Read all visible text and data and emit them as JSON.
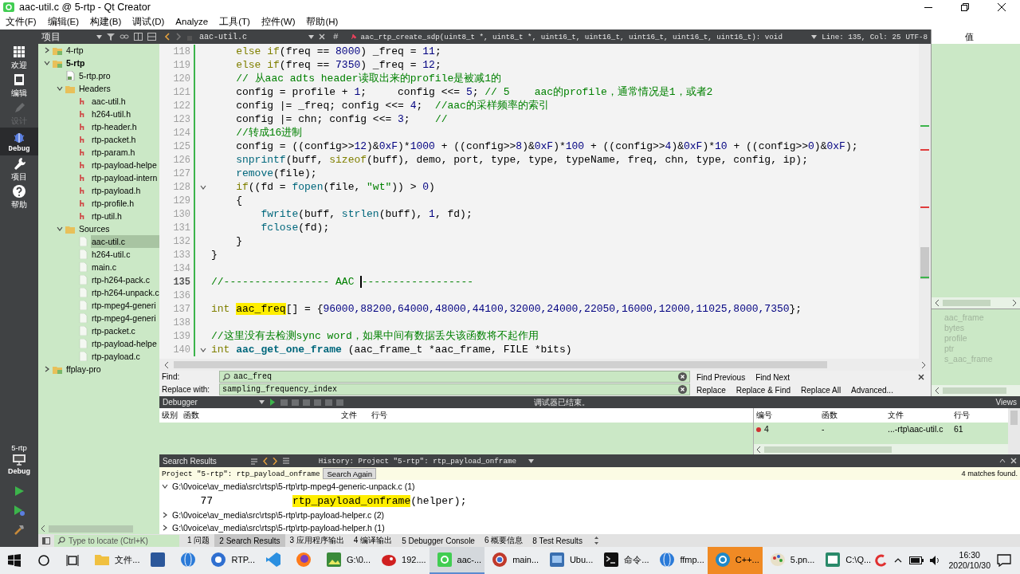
{
  "window": {
    "title": "aac-util.c @ 5-rtp - Qt Creator"
  },
  "menu": [
    "文件(F)",
    "编辑(E)",
    "构建(B)",
    "调试(D)",
    "Analyze",
    "工具(T)",
    "控件(W)",
    "帮助(H)"
  ],
  "modes": [
    {
      "label": "欢迎",
      "kind": "welcome",
      "selected": false,
      "disabled": false
    },
    {
      "label": "编辑",
      "kind": "edit",
      "selected": false,
      "disabled": false
    },
    {
      "label": "设计",
      "kind": "design",
      "selected": false,
      "disabled": true
    },
    {
      "label": "Debug",
      "kind": "debug",
      "selected": true,
      "disabled": false
    },
    {
      "label": "项目",
      "kind": "projects",
      "selected": false,
      "disabled": false
    },
    {
      "label": "帮助",
      "kind": "help",
      "selected": false,
      "disabled": false
    }
  ],
  "kit": {
    "project": "5-rtp",
    "build": "Debug"
  },
  "projects": {
    "title": "项目",
    "tree": [
      {
        "label": "4-rtp",
        "kind": "project",
        "active": false,
        "expanded": false,
        "selected": false
      },
      {
        "label": "5-rtp",
        "kind": "project",
        "active": true,
        "expanded": true,
        "selected": false,
        "children": [
          {
            "label": "5-rtp.pro",
            "kind": "pro",
            "selected": false
          },
          {
            "label": "Headers",
            "kind": "folder",
            "expanded": true,
            "selected": false,
            "children": [
              {
                "label": "aac-util.h",
                "kind": "header",
                "selected": false
              },
              {
                "label": "h264-util.h",
                "kind": "header",
                "selected": false
              },
              {
                "label": "rtp-header.h",
                "kind": "header",
                "selected": false
              },
              {
                "label": "rtp-packet.h",
                "kind": "header",
                "selected": false
              },
              {
                "label": "rtp-param.h",
                "kind": "header",
                "selected": false
              },
              {
                "label": "rtp-payload-helpe",
                "kind": "header",
                "selected": false
              },
              {
                "label": "rtp-payload-intern",
                "kind": "header",
                "selected": false
              },
              {
                "label": "rtp-payload.h",
                "kind": "header",
                "selected": false
              },
              {
                "label": "rtp-profile.h",
                "kind": "header",
                "selected": false
              },
              {
                "label": "rtp-util.h",
                "kind": "header",
                "selected": false
              }
            ]
          },
          {
            "label": "Sources",
            "kind": "folder",
            "expanded": true,
            "selected": false,
            "children": [
              {
                "label": "aac-util.c",
                "kind": "source",
                "selected": true
              },
              {
                "label": "h264-util.c",
                "kind": "source",
                "selected": false
              },
              {
                "label": "main.c",
                "kind": "source",
                "selected": false
              },
              {
                "label": "rtp-h264-pack.c",
                "kind": "source",
                "selected": false
              },
              {
                "label": "rtp-h264-unpack.c",
                "kind": "source",
                "selected": false
              },
              {
                "label": "rtp-mpeg4-generi",
                "kind": "source",
                "selected": false
              },
              {
                "label": "rtp-mpeg4-generi",
                "kind": "source",
                "selected": false
              },
              {
                "label": "rtp-packet.c",
                "kind": "source",
                "selected": false
              },
              {
                "label": "rtp-payload-helpe",
                "kind": "source",
                "selected": false
              },
              {
                "label": "rtp-payload.c",
                "kind": "source",
                "selected": false
              }
            ]
          }
        ]
      },
      {
        "label": "ffplay-pro",
        "kind": "project",
        "active": false,
        "expanded": false,
        "selected": false
      }
    ]
  },
  "editor": {
    "file": "aac-util.c",
    "hash": "#",
    "symbol": "aac_rtp_create_sdp(uint8_t *, uint8_t *, uint16_t, uint16_t, uint16_t, uint16_t, uint16_t): void",
    "position": "Line: 135, Col: 25",
    "encoding": "UTF-8",
    "lines": [
      {
        "number": "118",
        "current": false,
        "foldable": false,
        "spans": [
          {
            "kind": "keyword",
            "text": "    else if"
          },
          {
            "kind": "plain",
            "text": "(freq == "
          },
          {
            "kind": "number",
            "text": "8000"
          },
          {
            "kind": "plain",
            "text": ") _freq = "
          },
          {
            "kind": "number",
            "text": "11"
          },
          {
            "kind": "plain",
            "text": ";"
          }
        ]
      },
      {
        "number": "119",
        "current": false,
        "foldable": false,
        "spans": [
          {
            "kind": "keyword",
            "text": "    else if"
          },
          {
            "kind": "plain",
            "text": "(freq == "
          },
          {
            "kind": "number",
            "text": "7350"
          },
          {
            "kind": "plain",
            "text": ") _freq = "
          },
          {
            "kind": "number",
            "text": "12"
          },
          {
            "kind": "plain",
            "text": ";"
          }
        ]
      },
      {
        "number": "120",
        "current": false,
        "foldable": false,
        "spans": [
          {
            "kind": "comment",
            "text": "    // 从aac adts header读取出来的profile是被减1的"
          }
        ]
      },
      {
        "number": "121",
        "current": false,
        "foldable": false,
        "spans": [
          {
            "kind": "plain",
            "text": "    config = profile + "
          },
          {
            "kind": "number",
            "text": "1"
          },
          {
            "kind": "plain",
            "text": ";     config <<= "
          },
          {
            "kind": "number",
            "text": "5"
          },
          {
            "kind": "plain",
            "text": "; "
          },
          {
            "kind": "comment",
            "text": "// 5    aac的profile，通常情况是1，或者2"
          }
        ]
      },
      {
        "number": "122",
        "current": false,
        "foldable": false,
        "spans": [
          {
            "kind": "plain",
            "text": "    config |= _freq; config <<= "
          },
          {
            "kind": "number",
            "text": "4"
          },
          {
            "kind": "plain",
            "text": ";  "
          },
          {
            "kind": "comment",
            "text": "//aac的采样频率的索引"
          }
        ]
      },
      {
        "number": "123",
        "current": false,
        "foldable": false,
        "spans": [
          {
            "kind": "plain",
            "text": "    config |= chn; config <<= "
          },
          {
            "kind": "number",
            "text": "3"
          },
          {
            "kind": "plain",
            "text": ";    "
          },
          {
            "kind": "comment",
            "text": "//"
          }
        ]
      },
      {
        "number": "124",
        "current": false,
        "foldable": false,
        "spans": [
          {
            "kind": "comment",
            "text": "    //转成16进制"
          }
        ]
      },
      {
        "number": "125",
        "current": false,
        "foldable": false,
        "spans": [
          {
            "kind": "plain",
            "text": "    config = ((config>>"
          },
          {
            "kind": "number",
            "text": "12"
          },
          {
            "kind": "plain",
            "text": ")&"
          },
          {
            "kind": "number",
            "text": "0xF"
          },
          {
            "kind": "plain",
            "text": ")*"
          },
          {
            "kind": "number",
            "text": "1000"
          },
          {
            "kind": "plain",
            "text": " + ((config>>"
          },
          {
            "kind": "number",
            "text": "8"
          },
          {
            "kind": "plain",
            "text": ")&"
          },
          {
            "kind": "number",
            "text": "0xF"
          },
          {
            "kind": "plain",
            "text": ")*"
          },
          {
            "kind": "number",
            "text": "100"
          },
          {
            "kind": "plain",
            "text": " + ((config>>"
          },
          {
            "kind": "number",
            "text": "4"
          },
          {
            "kind": "plain",
            "text": ")&"
          },
          {
            "kind": "number",
            "text": "0xF"
          },
          {
            "kind": "plain",
            "text": ")*"
          },
          {
            "kind": "number",
            "text": "10"
          },
          {
            "kind": "plain",
            "text": " + ((config>>"
          },
          {
            "kind": "number",
            "text": "0"
          },
          {
            "kind": "plain",
            "text": ")&"
          },
          {
            "kind": "number",
            "text": "0xF"
          },
          {
            "kind": "plain",
            "text": ");"
          }
        ]
      },
      {
        "number": "126",
        "current": false,
        "foldable": false,
        "spans": [
          {
            "kind": "function",
            "text": "    snprintf"
          },
          {
            "kind": "plain",
            "text": "(buff, "
          },
          {
            "kind": "keyword",
            "text": "sizeof"
          },
          {
            "kind": "plain",
            "text": "(buff), demo, port, type, type, typeName, freq, chn, type, config, ip);"
          }
        ]
      },
      {
        "number": "127",
        "current": false,
        "foldable": false,
        "spans": [
          {
            "kind": "function",
            "text": "    remove"
          },
          {
            "kind": "plain",
            "text": "(file);"
          }
        ]
      },
      {
        "number": "128",
        "current": false,
        "foldable": true,
        "spans": [
          {
            "kind": "keyword",
            "text": "    if"
          },
          {
            "kind": "plain",
            "text": "((fd = "
          },
          {
            "kind": "function",
            "text": "fopen"
          },
          {
            "kind": "plain",
            "text": "(file, "
          },
          {
            "kind": "string",
            "text": "\"wt\""
          },
          {
            "kind": "plain",
            "text": ")) > "
          },
          {
            "kind": "number",
            "text": "0"
          },
          {
            "kind": "plain",
            "text": ")"
          }
        ]
      },
      {
        "number": "129",
        "current": false,
        "foldable": false,
        "spans": [
          {
            "kind": "plain",
            "text": "    {"
          }
        ]
      },
      {
        "number": "130",
        "current": false,
        "foldable": false,
        "spans": [
          {
            "kind": "function",
            "text": "        fwrite"
          },
          {
            "kind": "plain",
            "text": "(buff, "
          },
          {
            "kind": "function",
            "text": "strlen"
          },
          {
            "kind": "plain",
            "text": "(buff), "
          },
          {
            "kind": "number",
            "text": "1"
          },
          {
            "kind": "plain",
            "text": ", fd);"
          }
        ]
      },
      {
        "number": "131",
        "current": false,
        "foldable": false,
        "spans": [
          {
            "kind": "function",
            "text": "        fclose"
          },
          {
            "kind": "plain",
            "text": "(fd);"
          }
        ]
      },
      {
        "number": "132",
        "current": false,
        "foldable": false,
        "spans": [
          {
            "kind": "plain",
            "text": "    }"
          }
        ]
      },
      {
        "number": "133",
        "current": false,
        "foldable": false,
        "spans": [
          {
            "kind": "plain",
            "text": "}"
          }
        ]
      },
      {
        "number": "134",
        "current": false,
        "foldable": false
      },
      {
        "number": "135",
        "current": true,
        "foldable": false,
        "spans": [
          {
            "kind": "comment",
            "text": "//----------------- AAC "
          },
          {
            "kind": "comment",
            "text": "------------------"
          }
        ]
      },
      {
        "number": "136",
        "current": false,
        "foldable": false
      },
      {
        "number": "137",
        "current": false,
        "foldable": false,
        "spans": [
          {
            "kind": "keyword",
            "text": "int "
          },
          {
            "kind": "match",
            "text": "aac_freq"
          },
          {
            "kind": "plain",
            "text": "[] = {"
          },
          {
            "kind": "number",
            "text": "96000,88200,64000,48000,44100,32000,24000,22050,16000,12000,11025,8000,7350"
          },
          {
            "kind": "plain",
            "text": "};"
          }
        ]
      },
      {
        "number": "138",
        "current": false,
        "foldable": false
      },
      {
        "number": "139",
        "current": false,
        "foldable": false,
        "spans": [
          {
            "kind": "comment",
            "text": "//这里没有去检测sync word，如果中间有数据丢失该函数将不起作用"
          }
        ]
      },
      {
        "number": "140",
        "current": false,
        "foldable": true,
        "spans": [
          {
            "kind": "keyword",
            "text": "int "
          },
          {
            "kind": "definition",
            "text": "aac_get_one_frame"
          },
          {
            "kind": "plain",
            "text": " (aac_frame_t *aac_frame, FILE *bits)"
          }
        ]
      }
    ]
  },
  "right_panel": {
    "columns": [
      "值"
    ],
    "items": [
      {
        "name": "aac_frame",
        "disabled": true
      },
      {
        "name": "bytes",
        "disabled": true
      },
      {
        "name": "profile",
        "disabled": true
      },
      {
        "name": "ptr",
        "disabled": true
      },
      {
        "name": "s_aac_frame",
        "disabled": true
      }
    ]
  },
  "find": {
    "find_label": "Find:",
    "find_value": "aac_freq",
    "replace_label": "Replace with:",
    "replace_value": "sampling_frequency_index",
    "find_buttons": [
      "Find Previous",
      "Find Next"
    ],
    "replace_buttons": [
      "Replace",
      "Replace & Find",
      "Replace All",
      "Advanced..."
    ]
  },
  "debugger": {
    "selector": "Debugger",
    "status": "调试器已结束。",
    "views": "Views",
    "stack_columns": [
      "级别",
      "函数",
      "文件",
      "行号"
    ],
    "breakpoint_columns": [
      "编号",
      "函数",
      "文件",
      "行号"
    ],
    "breakpoints": [
      {
        "number": "4",
        "function": "-",
        "file": "...-rtp\\aac-util.c",
        "line": "61",
        "enabled": true
      }
    ]
  },
  "search_results": {
    "title": "Search Results",
    "history": "History: Project \"5-rtp\": rtp_payload_onframe",
    "query": "Project \"5-rtp\": rtp_payload_onframe",
    "again": "Search Again",
    "count": "4 matches found.",
    "files": [
      {
        "path": "G:\\0voice\\av_media\\src\\rtsp\\5-rtp\\rtp-mpeg4-generic-unpack.c (1)",
        "expanded": true,
        "matches": [
          {
            "line": "77",
            "match": "rtp_payload_onframe",
            "after": "(helper);"
          }
        ]
      },
      {
        "path": "G:\\0voice\\av_media\\src\\rtsp\\5-rtp\\rtp-payload-helper.c (2)",
        "expanded": false
      },
      {
        "path": "G:\\0voice\\av_media\\src\\rtsp\\5-rtp\\rtp-payload-helper.h (1)",
        "expanded": false
      }
    ]
  },
  "status_bar": {
    "locate": {
      "placeholder": "Type to locate (Ctrl+K)"
    },
    "tabs": [
      {
        "number": "1",
        "label": "问题",
        "selected": false
      },
      {
        "number": "2",
        "label": "Search Results",
        "selected": true
      },
      {
        "number": "3",
        "label": "应用程序输出",
        "selected": false
      },
      {
        "number": "4",
        "label": "编译输出",
        "selected": false
      },
      {
        "number": "5",
        "label": "Debugger Console",
        "selected": false
      },
      {
        "number": "6",
        "label": "概要信息",
        "selected": false
      },
      {
        "number": "8",
        "label": "Test Results",
        "selected": false
      }
    ]
  },
  "taskbar": {
    "apps": [
      {
        "kind": "folder",
        "label": "文件...",
        "selected": false,
        "attention": false
      },
      {
        "kind": "word",
        "selected": false,
        "attention": false
      },
      {
        "kind": "globe",
        "selected": false,
        "attention": false
      },
      {
        "kind": "s-app",
        "label": "RTP...",
        "selected": false,
        "attention": false
      },
      {
        "kind": "code",
        "selected": false,
        "attention": false
      },
      {
        "kind": "fox",
        "selected": false,
        "attention": false
      },
      {
        "kind": "image",
        "label": "G:\\0...",
        "selected": false,
        "attention": false
      },
      {
        "kind": "red-app",
        "label": "192....",
        "selected": false,
        "attention": false
      },
      {
        "kind": "qt",
        "label": "aac-...",
        "selected": true,
        "attention": false
      },
      {
        "kind": "chrome",
        "label": "main...",
        "selected": false,
        "attention": false
      },
      {
        "kind": "vm",
        "label": "Ubu...",
        "selected": false,
        "attention": false
      },
      {
        "kind": "terminal",
        "label": "命令...",
        "selected": false,
        "attention": false
      },
      {
        "kind": "globe",
        "label": "ffmp...",
        "selected": false,
        "attention": false
      },
      {
        "kind": "cpp",
        "label": "C++...",
        "selected": false,
        "attention": true
      },
      {
        "kind": "paint",
        "label": "5.pn...",
        "selected": false,
        "attention": false
      },
      {
        "kind": "window",
        "label": "C:\\Q...",
        "selected": false,
        "attention": false
      }
    ],
    "time": "16:30",
    "date": "2020/10/30"
  }
}
